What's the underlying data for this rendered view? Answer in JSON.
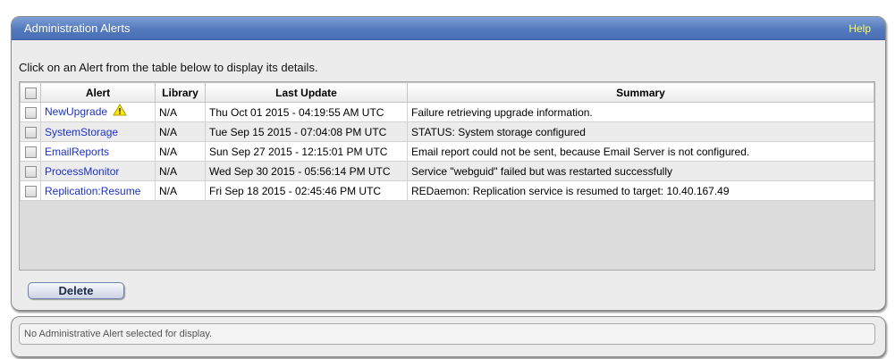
{
  "header": {
    "title": "Administration Alerts",
    "help_label": "Help"
  },
  "instructions": "Click on an Alert from the table below to display its details.",
  "table": {
    "columns": {
      "alert": "Alert",
      "library": "Library",
      "last_update": "Last Update",
      "summary": "Summary"
    },
    "rows": [
      {
        "alert": "NewUpgrade",
        "warning": true,
        "library": "N/A",
        "last_update": "Thu Oct 01 2015 - 04:19:55 AM UTC",
        "summary": "Failure retrieving upgrade information."
      },
      {
        "alert": "SystemStorage",
        "warning": false,
        "library": "N/A",
        "last_update": "Tue Sep 15 2015 - 07:04:08 PM UTC",
        "summary": "STATUS: System storage configured"
      },
      {
        "alert": "EmailReports",
        "warning": false,
        "library": "N/A",
        "last_update": "Sun Sep 27 2015 - 12:15:01 PM UTC",
        "summary": "Email report could not be sent, because Email Server is not configured."
      },
      {
        "alert": "ProcessMonitor",
        "warning": false,
        "library": "N/A",
        "last_update": "Wed Sep 30 2015 - 05:56:14 PM UTC",
        "summary": "Service \"webguid\" failed but was restarted successfully"
      },
      {
        "alert": "Replication:Resume",
        "warning": false,
        "library": "N/A",
        "last_update": "Fri Sep 18 2015 - 02:45:46 PM UTC",
        "summary": "REDaemon: Replication service is resumed to target: 10.40.167.49"
      }
    ]
  },
  "actions": {
    "delete_label": "Delete"
  },
  "details": {
    "message": "No Administrative Alert selected for display."
  },
  "colors": {
    "title_bar": "#5379bd",
    "help_link": "#ffff66",
    "alert_link": "#1a2fd1",
    "warning_icon": "#ffe800"
  },
  "icons": {
    "warning": "warning-icon"
  }
}
